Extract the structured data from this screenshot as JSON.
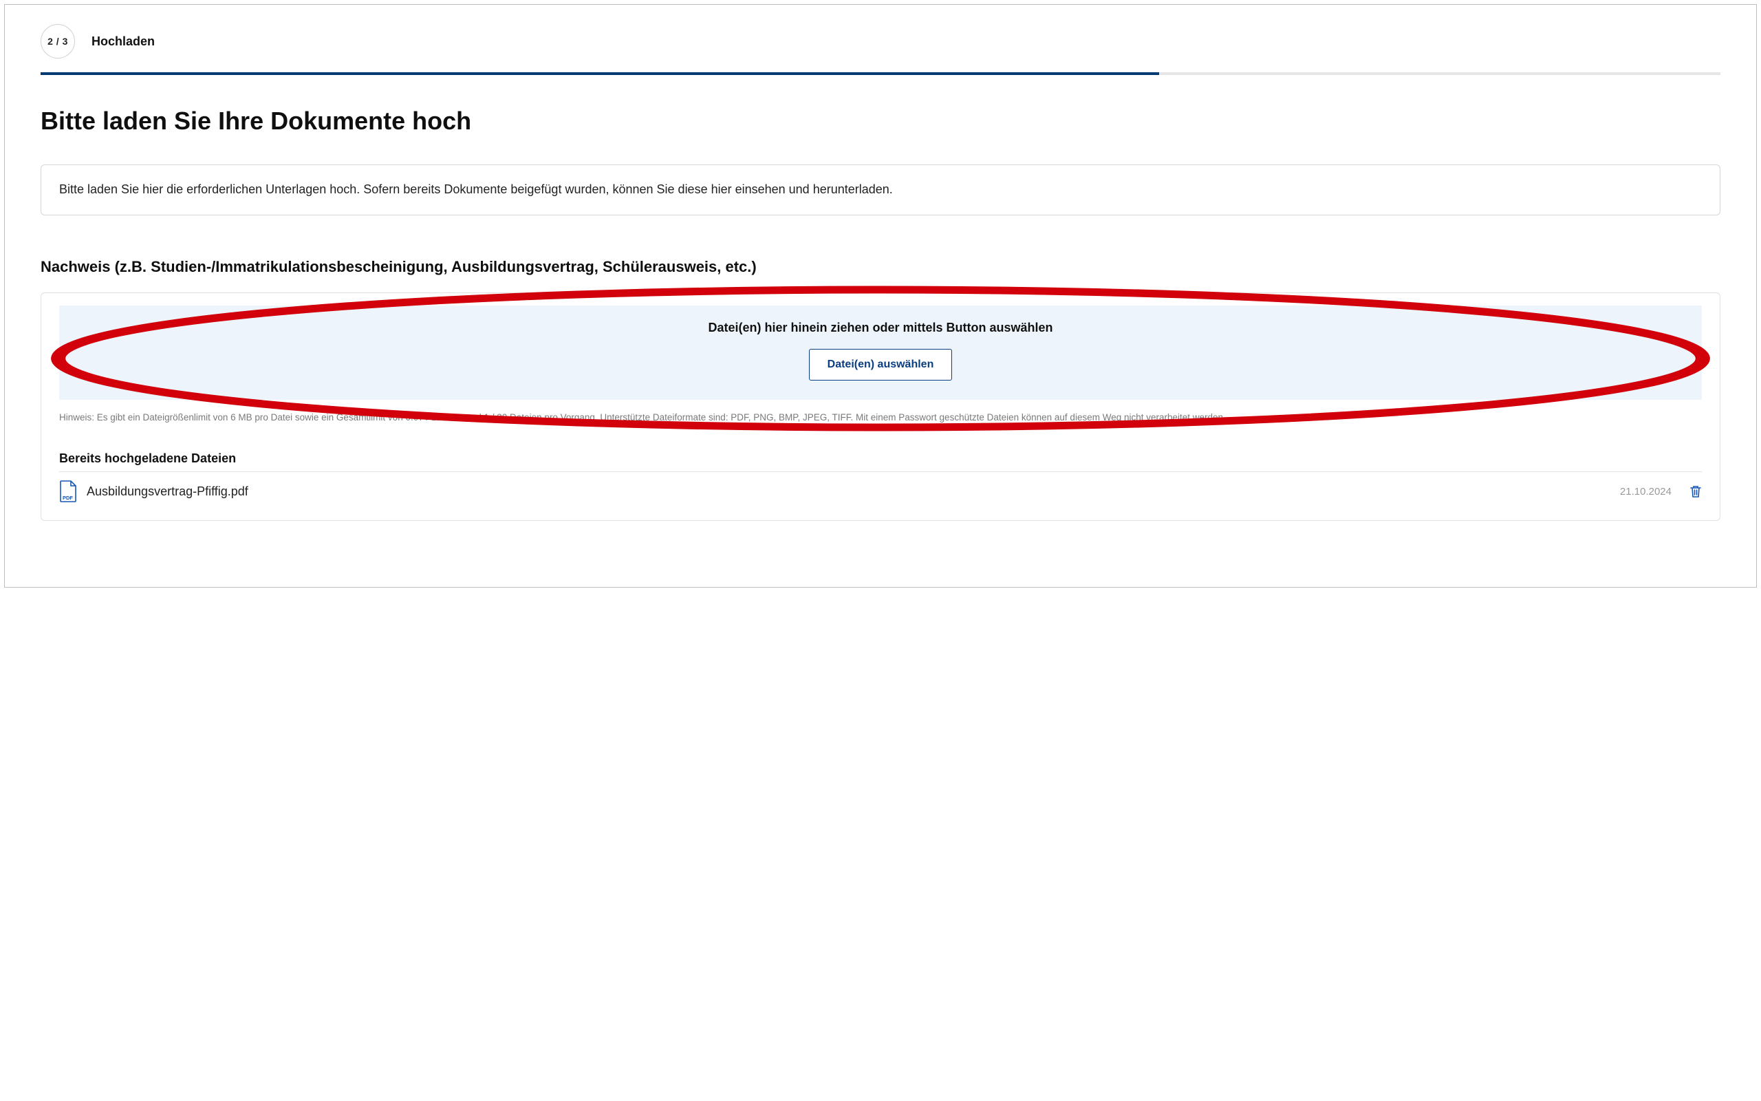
{
  "step": {
    "counter": "2 / 3",
    "label": "Hochladen",
    "progress_percent": 66.6
  },
  "page_title": "Bitte laden Sie Ihre Dokumente hoch",
  "info_text": "Bitte laden Sie hier die erforderlichen Unterlagen hoch. Sofern bereits Dokumente beigefügt wurden, können Sie diese hier einsehen und herunterladen.",
  "section_heading": "Nachweis (z.B. Studien-/Immatrikulationsbescheinigung, Ausbildungsvertrag, Schülerausweis, etc.)",
  "dropzone": {
    "prompt": "Datei(en) hier hinein ziehen oder mittels Button auswählen",
    "button_label": "Datei(en) auswählen"
  },
  "hint_text": "Hinweis: Es gibt ein Dateigrößenlimit von 6 MB pro Datei sowie ein Gesamtlimit von 0.07 / 120 MB und 1 / 30 Dateien pro Vorgang. Unterstützte Dateiformate sind: PDF, PNG, BMP, JPEG, TIFF. Mit einem Passwort geschützte Dateien können auf diesem Weg nicht verarbeitet werden.",
  "uploaded": {
    "heading": "Bereits hochgeladene Dateien",
    "files": [
      {
        "name": "Ausbildungsvertrag-Pfiffig.pdf",
        "date": "21.10.2024",
        "type": "PDF"
      }
    ]
  },
  "colors": {
    "brand": "#003a72",
    "link_blue": "#1557b6",
    "drop_bg": "#eef4fb",
    "annotation_red": "#d1000a"
  }
}
